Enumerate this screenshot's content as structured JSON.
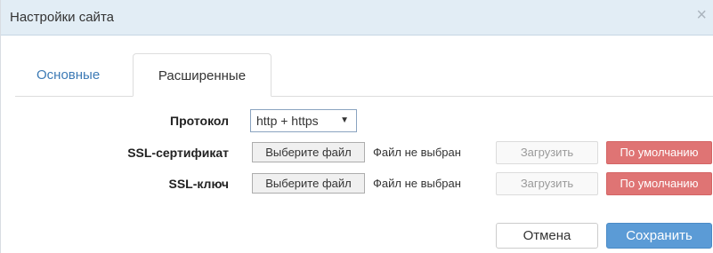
{
  "dialog": {
    "title": "Настройки сайта",
    "close_icon": "×"
  },
  "tabs": [
    {
      "label": "Основные",
      "active": false
    },
    {
      "label": "Расширенные",
      "active": true
    }
  ],
  "form": {
    "protocol": {
      "label": "Протокол",
      "selected": "http + https"
    },
    "ssl_certificate": {
      "label": "SSL-сертификат",
      "choose_label": "Выберите файл",
      "status": "Файл не выбран",
      "upload_label": "Загрузить",
      "default_label": "По умолчанию"
    },
    "ssl_key": {
      "label": "SSL-ключ",
      "choose_label": "Выберите файл",
      "status": "Файл не выбран",
      "upload_label": "Загрузить",
      "default_label": "По умолчанию"
    }
  },
  "footer": {
    "cancel_label": "Отмена",
    "save_label": "Сохранить"
  },
  "colors": {
    "titlebar_bg": "#e2edf5",
    "link": "#3c7ab5",
    "danger": "#df7474",
    "primary": "#5b9bd6"
  }
}
